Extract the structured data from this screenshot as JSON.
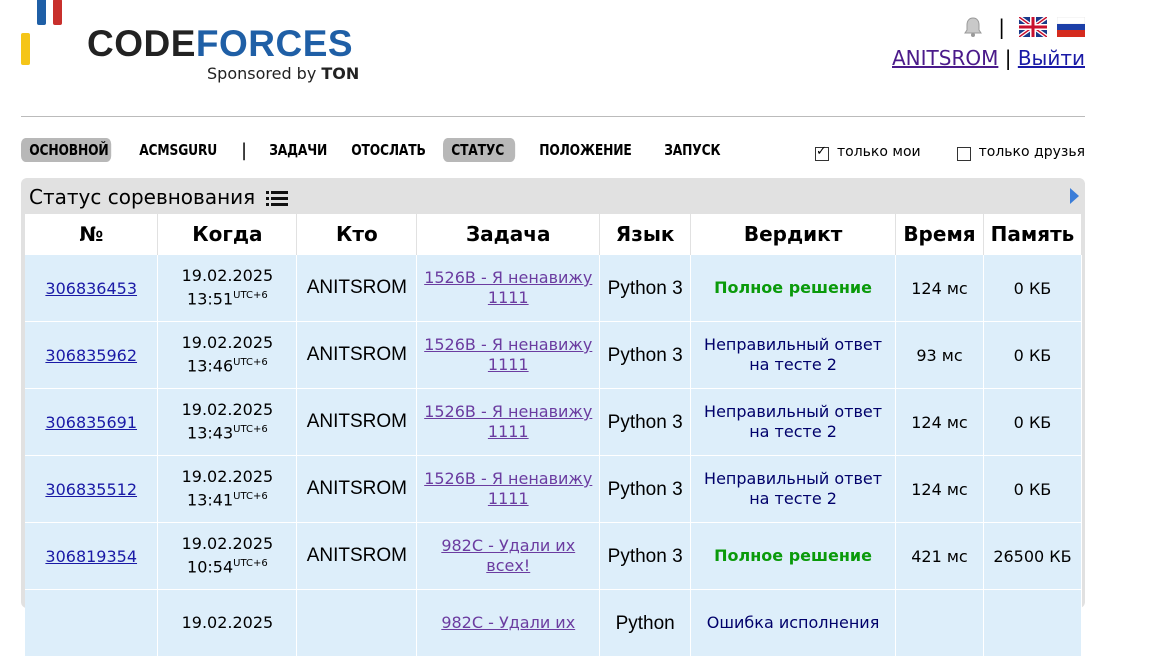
{
  "logo": {
    "name_part1": "CODE",
    "name_part2": "FORCES",
    "sponsor_prefix": "Sponsored by ",
    "sponsor_brand": "TON",
    "bar_colors": [
      "#f5c518",
      "#1f5fa6",
      "#c8302c"
    ]
  },
  "header": {
    "separator": "|",
    "username": "ANITSROM",
    "logout": "Выйти",
    "user_separator": "|"
  },
  "menu": {
    "items": [
      {
        "label": "ОСНОВНОЙ",
        "active": true
      },
      {
        "label": "ACMSGURU",
        "active": false
      },
      {
        "label": "ЗАДАЧИ",
        "active": false
      },
      {
        "label": "ОТОСЛАТЬ",
        "active": false
      },
      {
        "label": "СТАТУС",
        "active": true
      },
      {
        "label": "ПОЛОЖЕНИЕ",
        "active": false
      },
      {
        "label": "ЗАПУСК",
        "active": false
      }
    ],
    "separator": "|"
  },
  "filters": {
    "only_mine": "только мои",
    "only_mine_checked": true,
    "only_friends": "только друзья",
    "only_friends_checked": false
  },
  "panel": {
    "title": "Статус соревнования"
  },
  "table": {
    "headers": [
      "№",
      "Когда",
      "Кто",
      "Задача",
      "Язык",
      "Вердикт",
      "Время",
      "Память"
    ],
    "rows": [
      {
        "id": "306836453",
        "date": "19.02.2025",
        "time": "13:51",
        "tz": "UTC+6",
        "who": "ANITSROM",
        "problem": "1526B - Я ненавижу 1111",
        "lang": "Python 3",
        "verdict": "Полное решение",
        "ok": true,
        "time_used": "124 мс",
        "memory": "0 КБ"
      },
      {
        "id": "306835962",
        "date": "19.02.2025",
        "time": "13:46",
        "tz": "UTC+6",
        "who": "ANITSROM",
        "problem": "1526B - Я ненавижу 1111",
        "lang": "Python 3",
        "verdict": "Неправильный ответ на тесте 2",
        "ok": false,
        "time_used": "93 мс",
        "memory": "0 КБ"
      },
      {
        "id": "306835691",
        "date": "19.02.2025",
        "time": "13:43",
        "tz": "UTC+6",
        "who": "ANITSROM",
        "problem": "1526B - Я ненавижу 1111",
        "lang": "Python 3",
        "verdict": "Неправильный ответ на тесте 2",
        "ok": false,
        "time_used": "124 мс",
        "memory": "0 КБ"
      },
      {
        "id": "306835512",
        "date": "19.02.2025",
        "time": "13:41",
        "tz": "UTC+6",
        "who": "ANITSROM",
        "problem": "1526B - Я ненавижу 1111",
        "lang": "Python 3",
        "verdict": "Неправильный ответ на тесте 2",
        "ok": false,
        "time_used": "124 мс",
        "memory": "0 КБ"
      },
      {
        "id": "306819354",
        "date": "19.02.2025",
        "time": "10:54",
        "tz": "UTC+6",
        "who": "ANITSROM",
        "problem": "982C - Удали их всех!",
        "lang": "Python 3",
        "verdict": "Полное решение",
        "ok": true,
        "time_used": "421 мс",
        "memory": "26500 КБ"
      },
      {
        "id": "",
        "date": "19.02.2025",
        "time": "",
        "tz": "",
        "who": "",
        "problem": "982C - Удали их",
        "lang": "Python",
        "verdict": "Ошибка исполнения",
        "ok": false,
        "time_used": "",
        "memory": ""
      }
    ]
  }
}
